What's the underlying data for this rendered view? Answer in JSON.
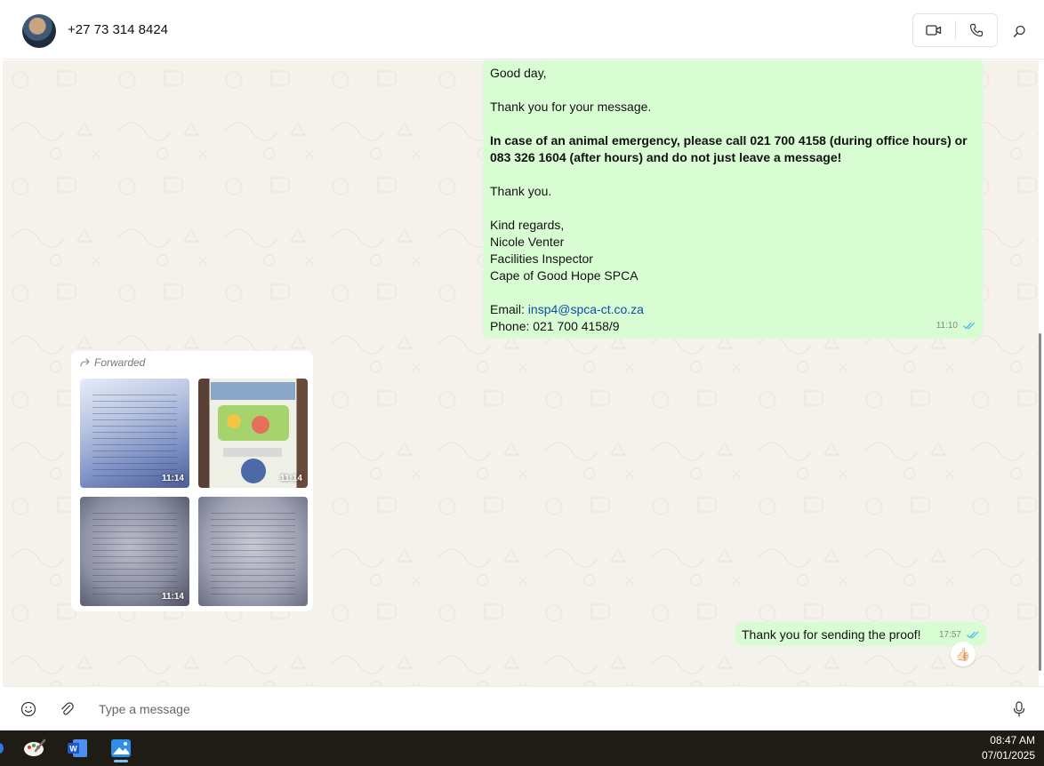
{
  "header": {
    "contact_name": "+27 73 314 8424",
    "icons": [
      "video-call-icon",
      "voice-call-icon",
      "search-icon"
    ]
  },
  "messages": {
    "auto_reply": {
      "lines": [
        {
          "text": "Good day,",
          "bold": false
        },
        {
          "text": "",
          "bold": false
        },
        {
          "text": "Thank you for your message.",
          "bold": false
        },
        {
          "text": "",
          "bold": false
        },
        {
          "text": "In case of an animal emergency, please call 021 700 4158 (during office hours) or 083 326 1604 (after hours) and do not just leave a message!",
          "bold": true
        },
        {
          "text": "",
          "bold": false
        },
        {
          "text": "Thank you.",
          "bold": false
        },
        {
          "text": "",
          "bold": false
        },
        {
          "text": "Kind regards,",
          "bold": false
        },
        {
          "text": "Nicole Venter",
          "bold": false
        },
        {
          "text": "Facilities Inspector",
          "bold": false
        },
        {
          "text": "Cape of Good Hope SPCA",
          "bold": false
        },
        {
          "text": "",
          "bold": false
        }
      ],
      "email_label": "Email: ",
      "email": "insp4@spca-ct.co.za",
      "phone": "Phone: 021 700 4158/9",
      "time": "11:10",
      "status": "read"
    },
    "forwarded": {
      "label": "Forwarded",
      "images": [
        {
          "time": "11:14"
        },
        {
          "time": "11:14"
        },
        {
          "time": "11:14"
        },
        {
          "time": ""
        }
      ]
    },
    "reply": {
      "text": "Thank you for sending the proof!",
      "time": "17:57",
      "status": "read",
      "reaction": "👍🏻"
    }
  },
  "composer": {
    "placeholder": "Type a message",
    "icons": [
      "emoji-icon",
      "attach-icon",
      "microphone-icon"
    ]
  },
  "taskbar": {
    "apps": [
      "paint-app-icon",
      "word-app-icon",
      "photos-app-icon"
    ],
    "time": "08:47 AM",
    "date": "07/01/2025"
  },
  "colors": {
    "outgoing_bubble": "#d9fdd3",
    "chat_background": "#f5f1eb",
    "read_tick": "#53bdeb",
    "link": "#0b4fa8"
  }
}
